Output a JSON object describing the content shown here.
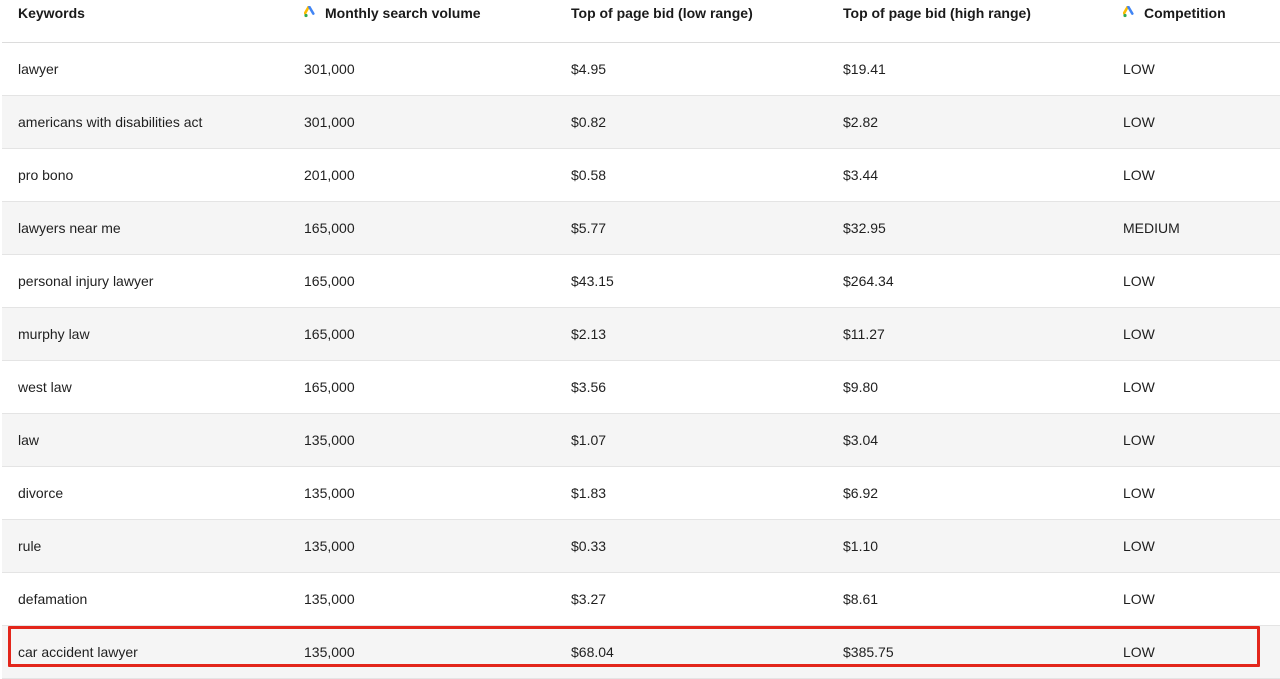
{
  "columns": {
    "keywords": "Keywords",
    "volume": "Monthly search volume",
    "low_bid": "Top of page bid (low range)",
    "high_bid": "Top of page bid (high range)",
    "competition": "Competition"
  },
  "icons": {
    "volume": "google-ads-icon",
    "competition": "google-ads-icon"
  },
  "colors": {
    "highlight": "#e3261b",
    "ads_blue": "#4285F4",
    "ads_yellow": "#FBBC04",
    "ads_green": "#34A853"
  },
  "rows": [
    {
      "keyword": "lawyer",
      "volume": "301,000",
      "low": "$4.95",
      "high": "$19.41",
      "competition": "LOW"
    },
    {
      "keyword": "americans with disabilities act",
      "volume": "301,000",
      "low": "$0.82",
      "high": "$2.82",
      "competition": "LOW"
    },
    {
      "keyword": "pro bono",
      "volume": "201,000",
      "low": "$0.58",
      "high": "$3.44",
      "competition": "LOW"
    },
    {
      "keyword": "lawyers near me",
      "volume": "165,000",
      "low": "$5.77",
      "high": "$32.95",
      "competition": "MEDIUM"
    },
    {
      "keyword": "personal injury lawyer",
      "volume": "165,000",
      "low": "$43.15",
      "high": "$264.34",
      "competition": "LOW"
    },
    {
      "keyword": "murphy law",
      "volume": "165,000",
      "low": "$2.13",
      "high": "$11.27",
      "competition": "LOW"
    },
    {
      "keyword": "west law",
      "volume": "165,000",
      "low": "$3.56",
      "high": "$9.80",
      "competition": "LOW"
    },
    {
      "keyword": "law",
      "volume": "135,000",
      "low": "$1.07",
      "high": "$3.04",
      "competition": "LOW"
    },
    {
      "keyword": "divorce",
      "volume": "135,000",
      "low": "$1.83",
      "high": "$6.92",
      "competition": "LOW"
    },
    {
      "keyword": "rule",
      "volume": "135,000",
      "low": "$0.33",
      "high": "$1.10",
      "competition": "LOW"
    },
    {
      "keyword": "defamation",
      "volume": "135,000",
      "low": "$3.27",
      "high": "$8.61",
      "competition": "LOW"
    },
    {
      "keyword": "car accident lawyer",
      "volume": "135,000",
      "low": "$68.04",
      "high": "$385.75",
      "competition": "LOW"
    }
  ]
}
